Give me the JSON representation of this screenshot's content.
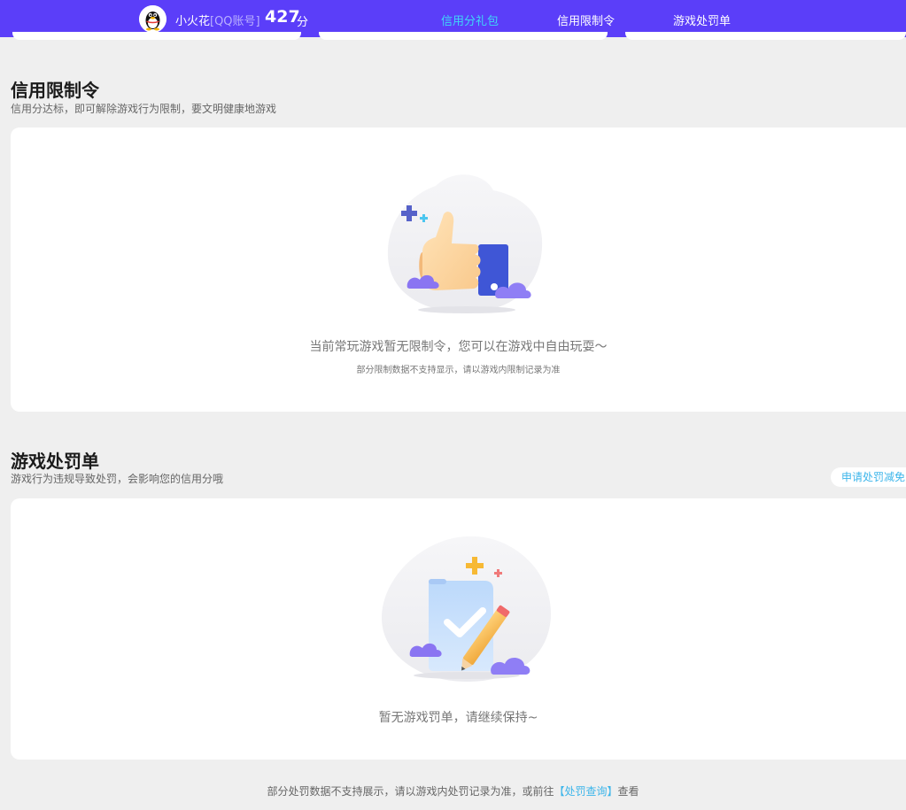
{
  "header": {
    "username": "小火花",
    "account_type": "[QQ账号]",
    "score": "427",
    "score_unit": "分",
    "tabs": [
      {
        "label": "信用分礼包",
        "active": true
      },
      {
        "label": "信用限制令",
        "active": false
      },
      {
        "label": "游戏处罚单",
        "active": false
      }
    ],
    "bg_color": "#5b3ef9",
    "active_tab_color": "#3fd8f7"
  },
  "restriction": {
    "title": "信用限制令",
    "subtitle": "信用分达标，即可解除游戏行为限制，要文明健康地游戏",
    "empty_text": "当前常玩游戏暂无限制令，您可以在游戏中自由玩耍～",
    "empty_note": "部分限制数据不支持显示，请以游戏内限制记录为准",
    "illustration_icon": "thumbs-up-icon"
  },
  "penalty": {
    "title": "游戏处罚单",
    "subtitle": "游戏行为违规导致处罚，会影响您的信用分哦",
    "appeal_button": "申请处罚减免",
    "empty_text": "暂无游戏罚单，请继续保持~",
    "illustration_icon": "checked-document-icon"
  },
  "footer": {
    "text_before": "部分处罚数据不支持展示，请以游戏内处罚记录为准，或前往",
    "link": "【处罚查询】",
    "text_after": "查看"
  }
}
